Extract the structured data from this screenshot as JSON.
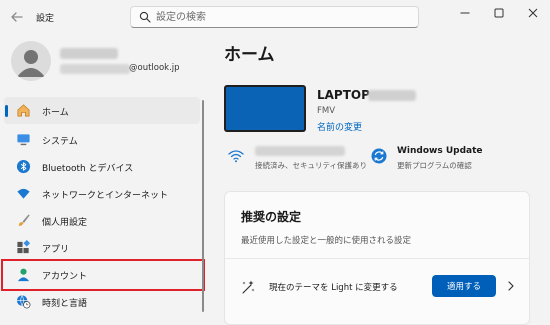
{
  "window": {
    "title": "設定",
    "search_placeholder": "設定の検索"
  },
  "profile": {
    "email_domain": "@outlook.jp"
  },
  "sidebar": {
    "items": [
      {
        "label": "ホーム",
        "icon": "home-icon",
        "selected": true
      },
      {
        "label": "システム",
        "icon": "monitor-icon",
        "selected": false
      },
      {
        "label": "Bluetooth とデバイス",
        "icon": "bluetooth-icon",
        "selected": false
      },
      {
        "label": "ネットワークとインターネット",
        "icon": "wifi-icon",
        "selected": false
      },
      {
        "label": "個人用設定",
        "icon": "brush-icon",
        "selected": false
      },
      {
        "label": "アプリ",
        "icon": "apps-icon",
        "selected": false
      },
      {
        "label": "アカウント",
        "icon": "person-icon",
        "selected": false
      },
      {
        "label": "時刻と言語",
        "icon": "globe-clock-icon",
        "selected": false
      }
    ]
  },
  "main": {
    "title": "ホーム",
    "device": {
      "name": "LAPTOP-",
      "model": "FMV",
      "rename_label": "名前の変更"
    },
    "network": {
      "status": "接続済み、セキュリティ保護あり"
    },
    "update": {
      "title": "Windows Update",
      "status": "更新プログラムの確認"
    },
    "recommended": {
      "title": "推奨の設定",
      "description": "最近使用した設定と一般的に使用される設定",
      "item_text": "現在のテーマを Light に変更する",
      "apply_label": "適用する"
    }
  },
  "colors": {
    "accent": "#0067c0",
    "button": "#005fb8",
    "highlight_box": "#e0202b",
    "background": "#f3f3f3"
  }
}
